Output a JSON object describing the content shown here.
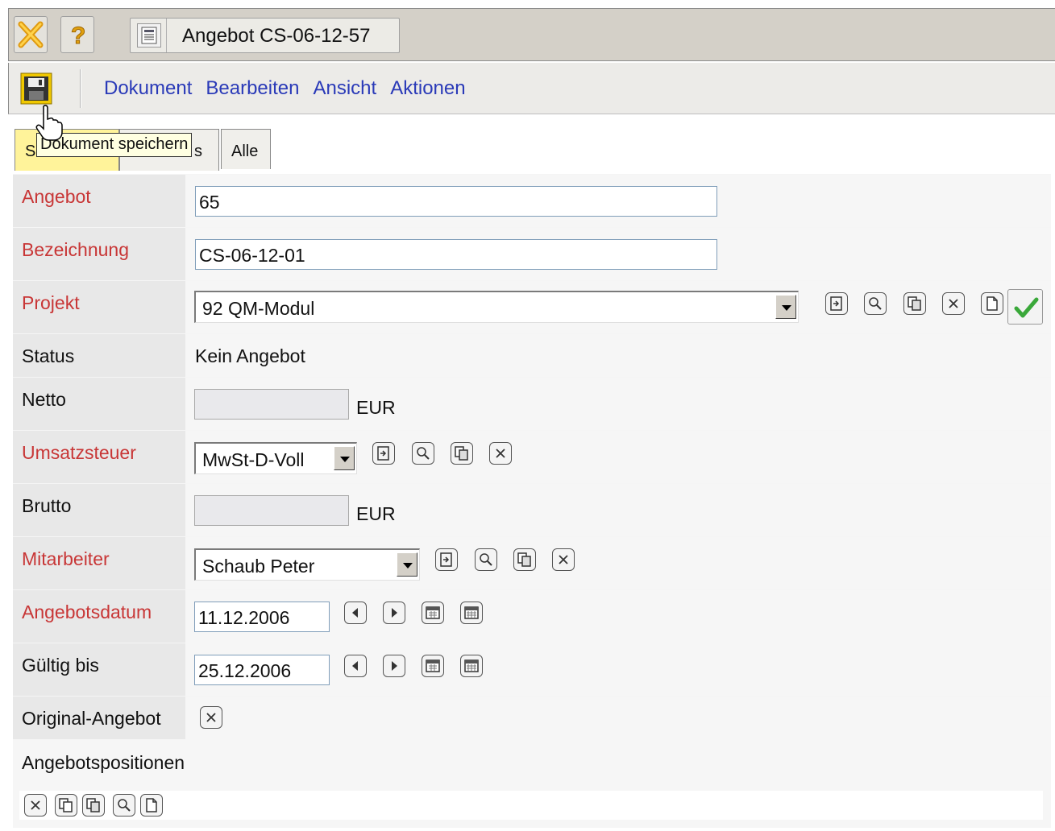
{
  "window": {
    "document_title": "Angebot CS-06-12-57"
  },
  "toolbar": {
    "save_tooltip": "Dokument speichern"
  },
  "menu": {
    "items": [
      "Dokument",
      "Bearbeiten",
      "Ansicht",
      "Aktionen"
    ]
  },
  "tabs": {
    "first_visible": "S",
    "second_visible": "s",
    "third": "Alle"
  },
  "form": {
    "angebot": {
      "label": "Angebot",
      "value": "65"
    },
    "bezeichnung": {
      "label": "Bezeichnung",
      "value": "CS-06-12-01"
    },
    "projekt": {
      "label": "Projekt",
      "value": "92 QM-Modul"
    },
    "status": {
      "label": "Status",
      "value": "Kein Angebot"
    },
    "netto": {
      "label": "Netto",
      "value": "",
      "unit": "EUR"
    },
    "umsatzsteuer": {
      "label": "Umsatzsteuer",
      "value": "MwSt-D-Voll"
    },
    "brutto": {
      "label": "Brutto",
      "value": "",
      "unit": "EUR"
    },
    "mitarbeiter": {
      "label": "Mitarbeiter",
      "value": "Schaub Peter"
    },
    "angebotsdatum": {
      "label": "Angebotsdatum",
      "value": "11.12.2006"
    },
    "gueltig_bis": {
      "label": "Gültig bis",
      "value": "25.12.2006"
    },
    "original_angebot": {
      "label": "Original-Angebot"
    },
    "angebotspositionen": {
      "label": "Angebotspositionen"
    }
  },
  "colors": {
    "required_label": "#c83636",
    "menu_link": "#2a3ab8",
    "active_tab": "#fff39a",
    "check": "#3aa83a"
  }
}
